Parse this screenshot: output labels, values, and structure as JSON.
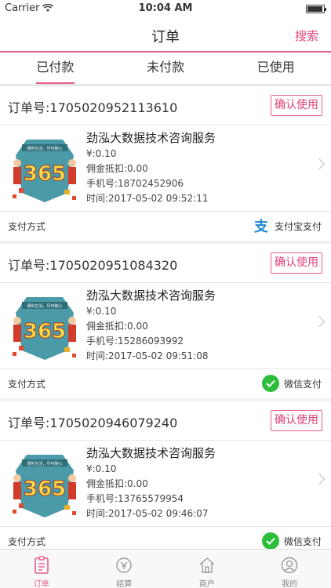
{
  "status_bar": {
    "carrier": "Carrier",
    "time": "10:04 AM"
  },
  "nav": {
    "title": "订单",
    "search": "搜索"
  },
  "tabs": [
    {
      "label": "已付款",
      "active": true
    },
    {
      "label": "未付款",
      "active": false
    },
    {
      "label": "已使用",
      "active": false
    }
  ],
  "orders": [
    {
      "order_no": "订单号:1705020952113610",
      "confirm": "确认使用",
      "title": "劲泓大数据技术咨询服务",
      "price": "¥:0.10",
      "deduction": "佣金抵扣:0.00",
      "phone": "手机号:18702452906",
      "time": "时间:2017-05-02 09:52:11",
      "pay_label": "支付方式",
      "pay_method": "支付宝支付",
      "pay_icon": "alipay-icon"
    },
    {
      "order_no": "订单号:1705020951084320",
      "confirm": "确认使用",
      "title": "劲泓大数据技术咨询服务",
      "price": "¥:0.10",
      "deduction": "佣金抵扣:0.00",
      "phone": "手机号:15286093992",
      "time": "时间:2017-05-02 09:51:08",
      "pay_label": "支付方式",
      "pay_method": "微信支付",
      "pay_icon": "wechat-icon"
    },
    {
      "order_no": "订单号:1705020946079240",
      "confirm": "确认使用",
      "title": "劲泓大数据技术咨询服务",
      "price": "¥:0.10",
      "deduction": "佣金抵扣:0.00",
      "phone": "手机号:13765579954",
      "time": "时间:2017-05-02 09:46:07",
      "pay_label": "支付方式",
      "pay_method": "微信支付",
      "pay_icon": "wechat-icon"
    }
  ],
  "thumb": {
    "badge": "365",
    "banner": "便利生活，尽可随心"
  },
  "tabbar": [
    {
      "label": "订单",
      "icon": "order-icon",
      "active": true
    },
    {
      "label": "结算",
      "icon": "settle-icon",
      "active": false
    },
    {
      "label": "商户",
      "icon": "merchant-icon",
      "active": false
    },
    {
      "label": "我的",
      "icon": "profile-icon",
      "active": false
    }
  ],
  "colors": {
    "accent": "#e85c8f",
    "alipay": "#1e88d6",
    "wechat": "#2cbe3a"
  }
}
